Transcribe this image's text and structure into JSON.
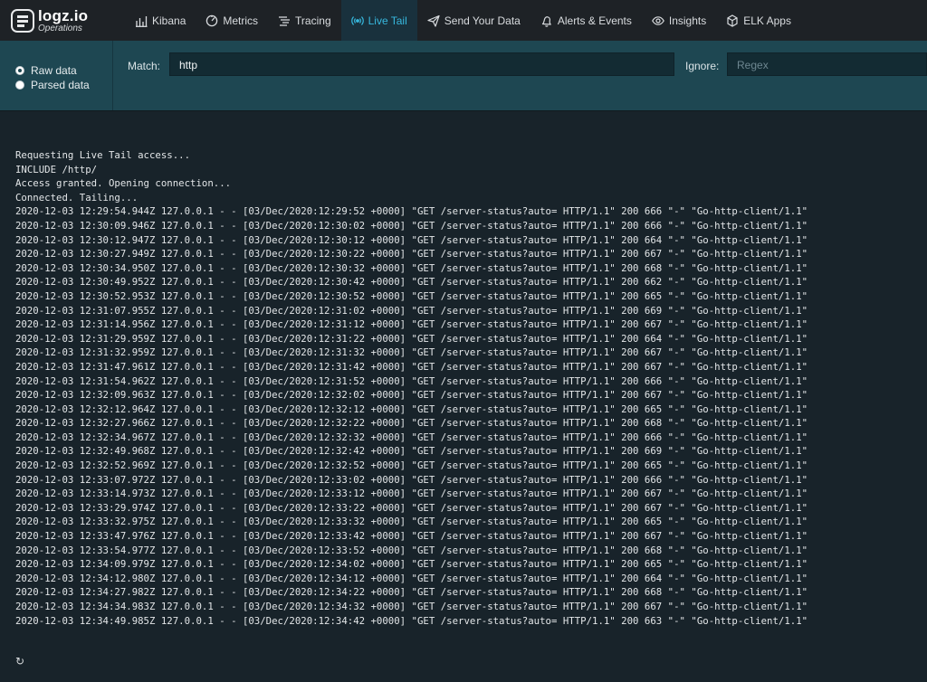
{
  "brand": {
    "name": "logz.io",
    "subtitle": "Operations"
  },
  "nav": [
    {
      "label": "Kibana",
      "icon": "bar-chart-icon",
      "active": false
    },
    {
      "label": "Metrics",
      "icon": "gauge-icon",
      "active": false
    },
    {
      "label": "Tracing",
      "icon": "tracing-icon",
      "active": false
    },
    {
      "label": "Live Tail",
      "icon": "broadcast-icon",
      "active": true
    },
    {
      "label": "Send Your Data",
      "icon": "send-icon",
      "active": false
    },
    {
      "label": "Alerts & Events",
      "icon": "bell-icon",
      "active": false
    },
    {
      "label": "Insights",
      "icon": "eye-icon",
      "active": false
    },
    {
      "label": "ELK Apps",
      "icon": "apps-icon",
      "active": false
    }
  ],
  "mode": {
    "raw_label": "Raw data",
    "parsed_label": "Parsed data",
    "selected": "raw"
  },
  "filters": {
    "match_label": "Match:",
    "match_value": "http",
    "ignore_label": "Ignore:",
    "ignore_placeholder": "Regex"
  },
  "log_lines": [
    "Requesting Live Tail access...",
    "INCLUDE /http/",
    "Access granted. Opening connection...",
    "Connected. Tailing...",
    "2020-12-03 12:29:54.944Z 127.0.0.1 - - [03/Dec/2020:12:29:52 +0000] \"GET /server-status?auto= HTTP/1.1\" 200 666 \"-\" \"Go-http-client/1.1\"",
    "2020-12-03 12:30:09.946Z 127.0.0.1 - - [03/Dec/2020:12:30:02 +0000] \"GET /server-status?auto= HTTP/1.1\" 200 666 \"-\" \"Go-http-client/1.1\"",
    "2020-12-03 12:30:12.947Z 127.0.0.1 - - [03/Dec/2020:12:30:12 +0000] \"GET /server-status?auto= HTTP/1.1\" 200 664 \"-\" \"Go-http-client/1.1\"",
    "2020-12-03 12:30:27.949Z 127.0.0.1 - - [03/Dec/2020:12:30:22 +0000] \"GET /server-status?auto= HTTP/1.1\" 200 667 \"-\" \"Go-http-client/1.1\"",
    "2020-12-03 12:30:34.950Z 127.0.0.1 - - [03/Dec/2020:12:30:32 +0000] \"GET /server-status?auto= HTTP/1.1\" 200 668 \"-\" \"Go-http-client/1.1\"",
    "2020-12-03 12:30:49.952Z 127.0.0.1 - - [03/Dec/2020:12:30:42 +0000] \"GET /server-status?auto= HTTP/1.1\" 200 662 \"-\" \"Go-http-client/1.1\"",
    "2020-12-03 12:30:52.953Z 127.0.0.1 - - [03/Dec/2020:12:30:52 +0000] \"GET /server-status?auto= HTTP/1.1\" 200 665 \"-\" \"Go-http-client/1.1\"",
    "2020-12-03 12:31:07.955Z 127.0.0.1 - - [03/Dec/2020:12:31:02 +0000] \"GET /server-status?auto= HTTP/1.1\" 200 669 \"-\" \"Go-http-client/1.1\"",
    "2020-12-03 12:31:14.956Z 127.0.0.1 - - [03/Dec/2020:12:31:12 +0000] \"GET /server-status?auto= HTTP/1.1\" 200 667 \"-\" \"Go-http-client/1.1\"",
    "2020-12-03 12:31:29.959Z 127.0.0.1 - - [03/Dec/2020:12:31:22 +0000] \"GET /server-status?auto= HTTP/1.1\" 200 664 \"-\" \"Go-http-client/1.1\"",
    "2020-12-03 12:31:32.959Z 127.0.0.1 - - [03/Dec/2020:12:31:32 +0000] \"GET /server-status?auto= HTTP/1.1\" 200 667 \"-\" \"Go-http-client/1.1\"",
    "2020-12-03 12:31:47.961Z 127.0.0.1 - - [03/Dec/2020:12:31:42 +0000] \"GET /server-status?auto= HTTP/1.1\" 200 667 \"-\" \"Go-http-client/1.1\"",
    "2020-12-03 12:31:54.962Z 127.0.0.1 - - [03/Dec/2020:12:31:52 +0000] \"GET /server-status?auto= HTTP/1.1\" 200 666 \"-\" \"Go-http-client/1.1\"",
    "2020-12-03 12:32:09.963Z 127.0.0.1 - - [03/Dec/2020:12:32:02 +0000] \"GET /server-status?auto= HTTP/1.1\" 200 667 \"-\" \"Go-http-client/1.1\"",
    "2020-12-03 12:32:12.964Z 127.0.0.1 - - [03/Dec/2020:12:32:12 +0000] \"GET /server-status?auto= HTTP/1.1\" 200 665 \"-\" \"Go-http-client/1.1\"",
    "2020-12-03 12:32:27.966Z 127.0.0.1 - - [03/Dec/2020:12:32:22 +0000] \"GET /server-status?auto= HTTP/1.1\" 200 668 \"-\" \"Go-http-client/1.1\"",
    "2020-12-03 12:32:34.967Z 127.0.0.1 - - [03/Dec/2020:12:32:32 +0000] \"GET /server-status?auto= HTTP/1.1\" 200 666 \"-\" \"Go-http-client/1.1\"",
    "2020-12-03 12:32:49.968Z 127.0.0.1 - - [03/Dec/2020:12:32:42 +0000] \"GET /server-status?auto= HTTP/1.1\" 200 669 \"-\" \"Go-http-client/1.1\"",
    "2020-12-03 12:32:52.969Z 127.0.0.1 - - [03/Dec/2020:12:32:52 +0000] \"GET /server-status?auto= HTTP/1.1\" 200 665 \"-\" \"Go-http-client/1.1\"",
    "2020-12-03 12:33:07.972Z 127.0.0.1 - - [03/Dec/2020:12:33:02 +0000] \"GET /server-status?auto= HTTP/1.1\" 200 666 \"-\" \"Go-http-client/1.1\"",
    "2020-12-03 12:33:14.973Z 127.0.0.1 - - [03/Dec/2020:12:33:12 +0000] \"GET /server-status?auto= HTTP/1.1\" 200 667 \"-\" \"Go-http-client/1.1\"",
    "2020-12-03 12:33:29.974Z 127.0.0.1 - - [03/Dec/2020:12:33:22 +0000] \"GET /server-status?auto= HTTP/1.1\" 200 667 \"-\" \"Go-http-client/1.1\"",
    "2020-12-03 12:33:32.975Z 127.0.0.1 - - [03/Dec/2020:12:33:32 +0000] \"GET /server-status?auto= HTTP/1.1\" 200 665 \"-\" \"Go-http-client/1.1\"",
    "2020-12-03 12:33:47.976Z 127.0.0.1 - - [03/Dec/2020:12:33:42 +0000] \"GET /server-status?auto= HTTP/1.1\" 200 667 \"-\" \"Go-http-client/1.1\"",
    "2020-12-03 12:33:54.977Z 127.0.0.1 - - [03/Dec/2020:12:33:52 +0000] \"GET /server-status?auto= HTTP/1.1\" 200 668 \"-\" \"Go-http-client/1.1\"",
    "2020-12-03 12:34:09.979Z 127.0.0.1 - - [03/Dec/2020:12:34:02 +0000] \"GET /server-status?auto= HTTP/1.1\" 200 665 \"-\" \"Go-http-client/1.1\"",
    "2020-12-03 12:34:12.980Z 127.0.0.1 - - [03/Dec/2020:12:34:12 +0000] \"GET /server-status?auto= HTTP/1.1\" 200 664 \"-\" \"Go-http-client/1.1\"",
    "2020-12-03 12:34:27.982Z 127.0.0.1 - - [03/Dec/2020:12:34:22 +0000] \"GET /server-status?auto= HTTP/1.1\" 200 668 \"-\" \"Go-http-client/1.1\"",
    "2020-12-03 12:34:34.983Z 127.0.0.1 - - [03/Dec/2020:12:34:32 +0000] \"GET /server-status?auto= HTTP/1.1\" 200 667 \"-\" \"Go-http-client/1.1\"",
    "2020-12-03 12:34:49.985Z 127.0.0.1 - - [03/Dec/2020:12:34:42 +0000] \"GET /server-status?auto= HTTP/1.1\" 200 663 \"-\" \"Go-http-client/1.1\""
  ],
  "spinner_icon": "loading-spinner-icon",
  "colors": {
    "accent": "#37b8de",
    "topbar": "#1e2226",
    "panel": "#1e4752",
    "log_bg": "#18232a"
  }
}
